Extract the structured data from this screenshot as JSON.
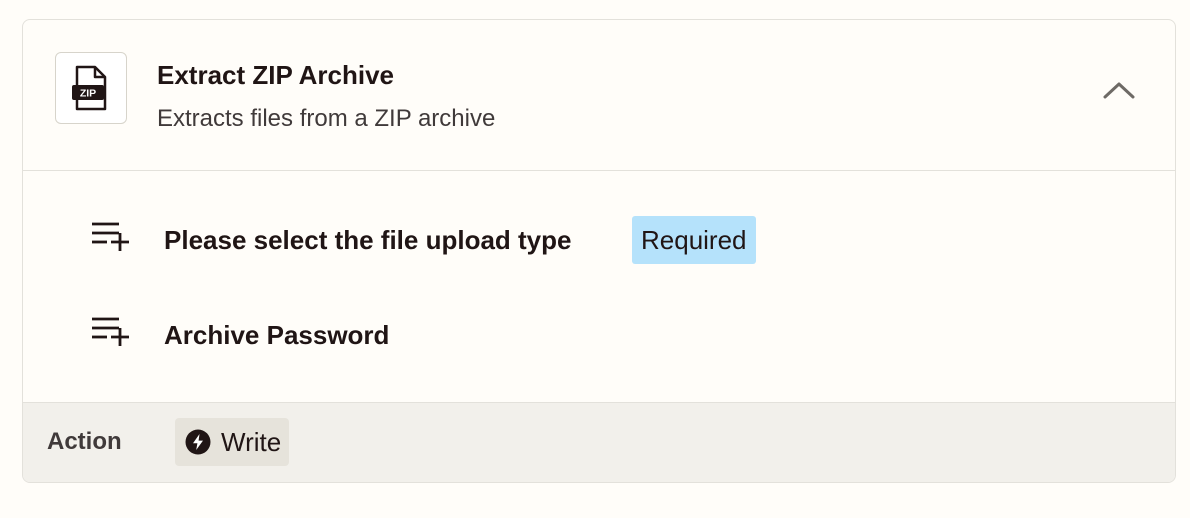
{
  "app": {
    "title": "Extract ZIP Archive",
    "subtitle": "Extracts files from a ZIP archive",
    "icon": "zip-file-icon",
    "icon_text": "ZIP"
  },
  "fields": [
    {
      "label": "Please select the file upload type",
      "badge": "Required",
      "icon": "add-field-icon"
    },
    {
      "label": "Archive Password",
      "icon": "add-field-icon"
    }
  ],
  "footer": {
    "label": "Action",
    "type": "Write",
    "type_icon": "lightning-bolt-icon"
  },
  "colors": {
    "badge_bg": "#b5e2fb",
    "footer_bg": "#f2f0eb",
    "text": "#201515"
  }
}
